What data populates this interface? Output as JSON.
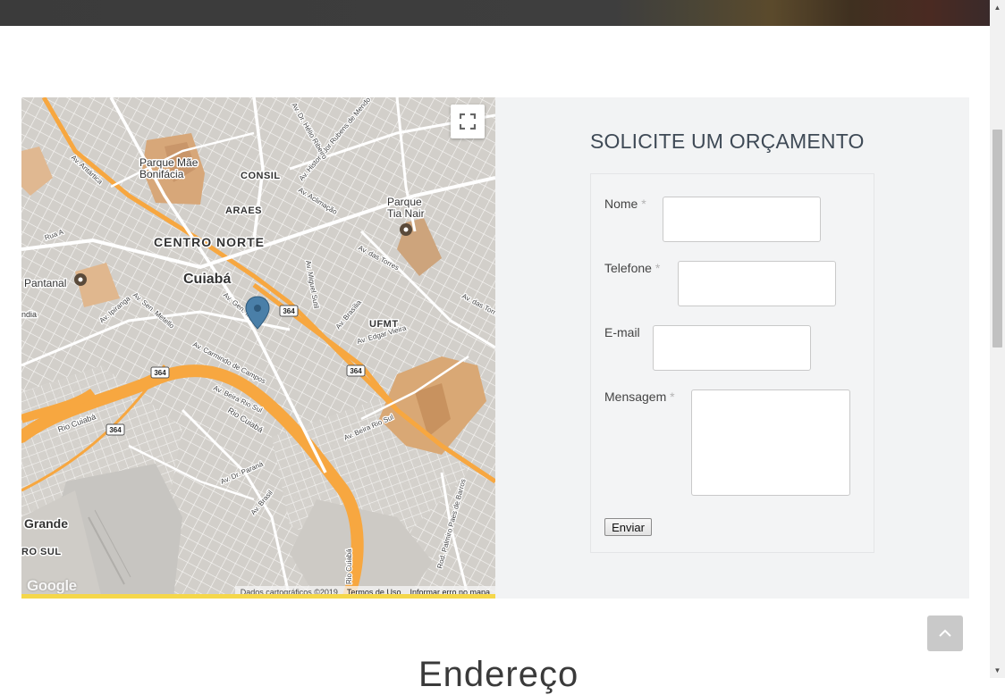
{
  "map": {
    "places": {
      "parque_mae_bonifacia": "Parque Mãe\nBonifácia",
      "consil": "CONSIL",
      "araes": "ARAES",
      "centro_norte": "CENTRO NORTE",
      "cuiaba": "Cuiabá",
      "pantanal": "Pantanal",
      "parque_tia_nair": "Parque\nTia Nair",
      "ufmt": "UFMT",
      "grande": "Grande",
      "ro_sul": "RO SUL",
      "landia": "ndia"
    },
    "roads": {
      "av_antartica": "Av. Antártica",
      "rio_cuiaba_1": "Rio Cuiabá",
      "rio_cuiaba_2": "Rio Cuiabá",
      "av_beira_rio_sul_1": "Av. Beira Rio Sul",
      "av_beira_rio_sul_2": "Av. Beira Rio Sul",
      "av_carmindo": "Av. Carmindo de Campos",
      "av_edgar_vieira": "Av. Edgar Vieira",
      "av_das_torres_1": "Av. das Torres",
      "av_das_torres_2": "Av. das Torres",
      "av_ipiranga": "Av. Ipiranga",
      "av_sen_metello": "Av. Sen. Metello",
      "av_gen_mello": "Av. Gen. M",
      "av_dr_parana": "Av. Dr. Paraná",
      "av_brasil": "Av. Brasil",
      "av_brasilia": "Av. Brasília",
      "av_rubens": "Av. Historiador Rubens de Mendo",
      "av_helio": "Av. Dr. Hélio Ribeiro",
      "av_aclimacao": "Av. Aclimação",
      "av_miguel_sutil": "Av. Miguel Sutil",
      "rua_a": "Rua A",
      "rod_palmiro": "Rod. Palmiro Paes de Barros",
      "rio_cuiaba_v": "Rio Cuiabá",
      "highway_364": "364"
    },
    "attribution": "Dados cartográficos ©2019",
    "terms_link": "Termos de Uso",
    "report_link": "Informar erro no mapa",
    "google_logo": "Google"
  },
  "form": {
    "title": "SOLICITE UM ORÇAMENTO",
    "required_mark": "*",
    "name_label": "Nome",
    "phone_label": "Telefone",
    "email_label": "E-mail",
    "message_label": "Mensagem",
    "submit_label": "Enviar"
  },
  "bottom_heading": "Endereço",
  "colors": {
    "map_bg": "#d9d6d1",
    "major_road": "#f7a740",
    "minor_road": "#ffffff",
    "park": "#d7a779",
    "panel_bg": "#f2f3f4",
    "title": "#3f4a56"
  }
}
